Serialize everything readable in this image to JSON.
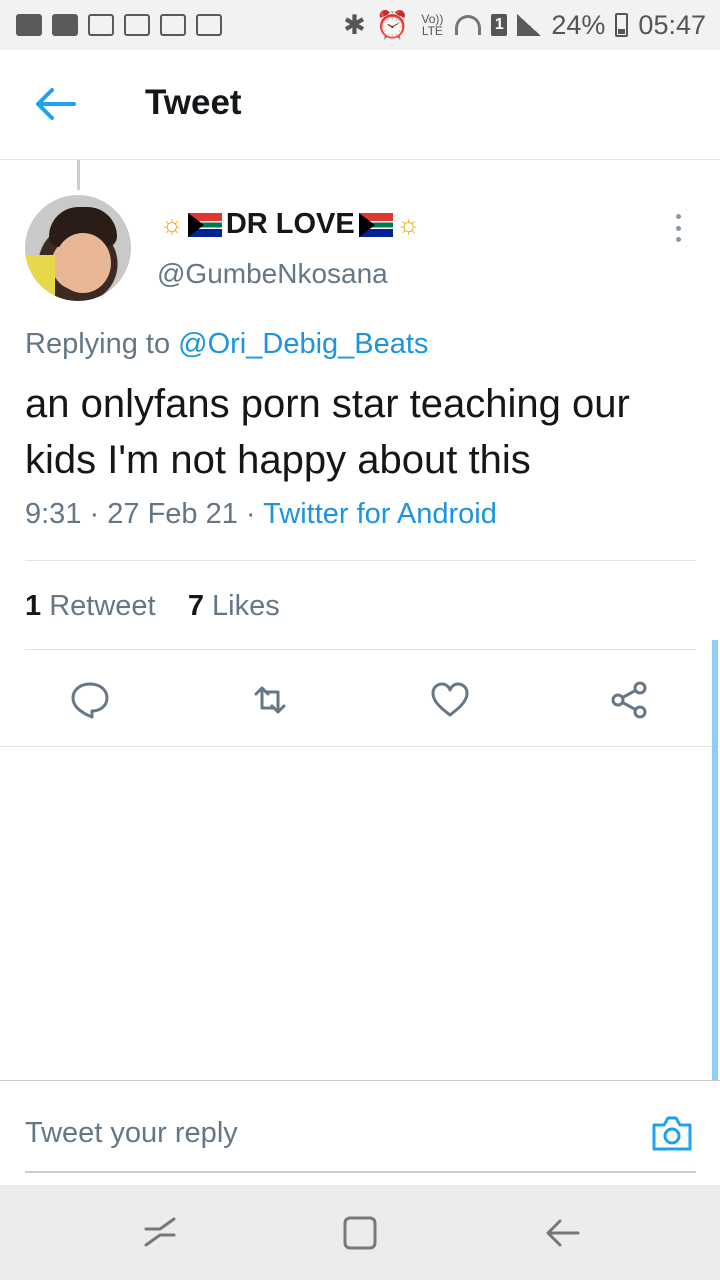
{
  "status_bar": {
    "battery": "24%",
    "time": "05:47",
    "volte": "Vo)) LTE",
    "sim": "1"
  },
  "header": {
    "title": "Tweet"
  },
  "tweet": {
    "display_name": "DR LOVE",
    "handle": "@GumbeNkosana",
    "replying_label": "Replying to",
    "replying_to": "@Ori_Debig_Beats",
    "text": "an onlyfans porn star teaching our kids I'm not happy about this",
    "time": "9:31",
    "date": "27 Feb 21",
    "separator": "·",
    "source": "Twitter for Android",
    "retweets_count": "1",
    "retweets_label": "Retweet",
    "likes_count": "7",
    "likes_label": "Likes"
  },
  "reply": {
    "placeholder": "Tweet your reply"
  },
  "colors": {
    "accent": "#1b95e0",
    "text": "#14171a",
    "secondary": "#657786"
  },
  "icons": {
    "back": "arrow-left-icon",
    "more": "more-vertical-icon",
    "reply": "reply-icon",
    "retweet": "retweet-icon",
    "like": "heart-icon",
    "share": "share-icon",
    "camera": "camera-icon"
  }
}
